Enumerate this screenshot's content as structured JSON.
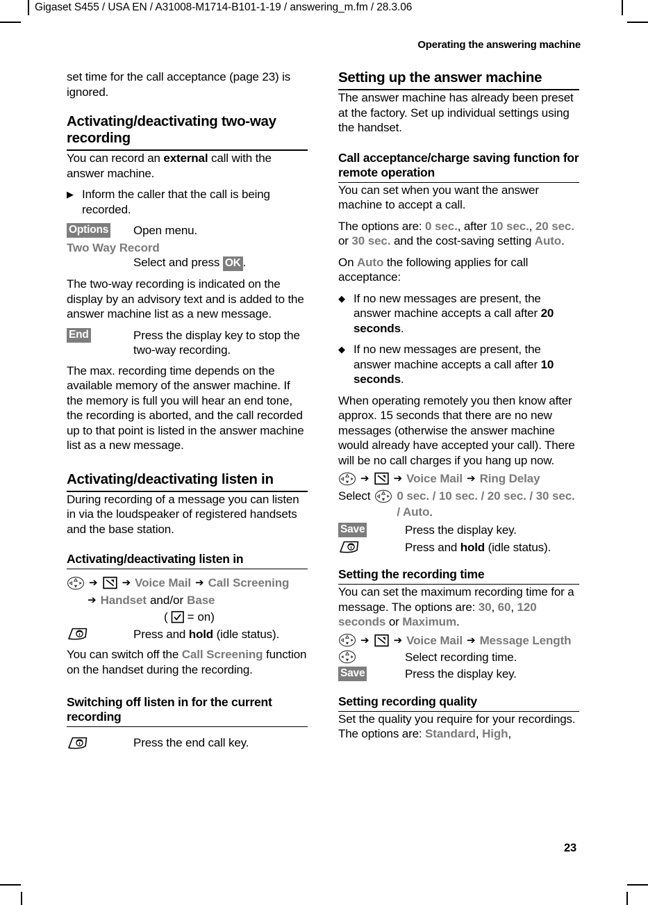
{
  "page": {
    "fm_header": "Gigaset S455 / USA EN / A31008-M1714-B101-1-19  / answering_m.fm / 28.3.06",
    "chapter_header": "Operating the answering machine",
    "page_number": "23"
  },
  "icons": {
    "nav_key": "navigation-key-icon",
    "tape_key": "answer-machine-key-icon",
    "end_call_key": "end-call-key-icon",
    "checkbox_on": "checkbox-checked-icon",
    "arrow": "➔",
    "triangle_bullet": "▶",
    "diamond_bullet": "◆"
  },
  "left_column": {
    "intro_text": "set time for the call acceptance (page 23) is ignored.",
    "section_two_way": {
      "title": "Activating/deactivating two-way recording",
      "p1_a": "You can record an ",
      "p1_bold": "external",
      "p1_b": " call with the answer machine.",
      "bullet1": "Inform the caller that the call is being recorded.",
      "key_options": "Options",
      "key_options_desc": "Open menu.",
      "menu_two_way_record": "Two Way Record",
      "select_press_a": "Select and press ",
      "key_ok": "OK",
      "select_press_b": ".",
      "p2": "The two-way recording is indicated on the display by an advisory text and is added to the answer machine list as a new message.",
      "key_end": "End",
      "key_end_desc": "Press the display key to stop the two-way recording.",
      "p3": "The max. recording time depends on the available memory of the answer machine. If the memory is full you will hear an end tone, the recording is aborted, and the call recorded up to that point is listed in the answer machine list as a new message."
    },
    "section_listen_in": {
      "title": "Activating/deactivating listen in",
      "p1": "During recording of a message you can listen in via the loudspeaker of registered handsets and the base station.",
      "sub_title": "Activating/deactivating listen in",
      "nav_voice_mail": "Voice Mail",
      "nav_call_screening": "Call Screening",
      "nav_handset": "Handset",
      "nav_andor": "and/or",
      "nav_base": "Base",
      "checkbox_note_open": "(",
      "checkbox_note_close": "= on)",
      "end_key_desc_a": "Press and ",
      "end_key_desc_bold": "hold",
      "end_key_desc_b": " (idle status).",
      "p2_a": "You can switch off the ",
      "p2_menu": "Call Screening",
      "p2_b": " function on the handset during the recording."
    },
    "section_switch_off": {
      "title": "Switching off listen in for the current recording",
      "end_key_desc": "Press the end call key."
    }
  },
  "right_column": {
    "section_setup": {
      "title": "Setting up the answer machine",
      "p1": "The answer machine has already been preset at the factory. Set up individual settings using the handset."
    },
    "section_call_acceptance": {
      "title": "Call acceptance/charge saving function for remote operation",
      "p1": "You can set when you want the answer machine to accept a call.",
      "p2_a": "The options are: ",
      "p2_opt1": "0 sec.",
      "p2_b": ", after ",
      "p2_opt2": "10 sec.",
      "p2_c": ", ",
      "p2_opt3": "20 sec.",
      "p2_d": " or ",
      "p2_opt4": "30 sec.",
      "p2_e": " and the cost-saving setting ",
      "p2_opt5": "Auto",
      "p2_f": ".",
      "p3_a": "On ",
      "p3_menu": "Auto",
      "p3_b": " the following applies for call acceptance:",
      "bullet1_a": "If no new messages are present, the answer machine accepts a call after ",
      "bullet1_bold": "20 seconds",
      "bullet1_b": ".",
      "bullet2_a": "If no new messages are present, the answer machine accepts a call after ",
      "bullet2_bold": "10 seconds",
      "bullet2_b": ".",
      "p4": "When operating remotely you then know after approx. 15 seconds that there are no new messages (otherwise the answer machine would already have accepted your call). There will be no call charges if you hang up now.",
      "nav_voice_mail": "Voice Mail",
      "nav_ring_delay": "Ring Delay",
      "select_label": "Select",
      "select_options": "0 sec. / 10 sec. / 20 sec. / 30 sec. / Auto",
      "select_options_period": ".",
      "key_save": "Save",
      "key_save_desc": "Press the display key.",
      "end_key_desc_a": "Press and ",
      "end_key_desc_bold": "hold",
      "end_key_desc_b": " (idle status)."
    },
    "section_recording_time": {
      "title": "Setting the recording time",
      "p1_a": "You can set the maximum recording time for a message. The options are: ",
      "p1_opt1": "30",
      "p1_b": ", ",
      "p1_opt2": "60",
      "p1_c": ", ",
      "p1_opt3": "120 seconds",
      "p1_d": " or ",
      "p1_opt4": "Maximum",
      "p1_e": ".",
      "nav_voice_mail": "Voice Mail",
      "nav_message_length": "Message Length",
      "nav_select_desc": "Select recording time.",
      "key_save": "Save",
      "key_save_desc": "Press the display key."
    },
    "section_recording_quality": {
      "title": "Setting recording quality",
      "p1_a": "Set the quality you require for your recordings. The options are: ",
      "p1_opt1": "Standard",
      "p1_b": ", ",
      "p1_opt2": "High",
      "p1_c": ","
    }
  }
}
